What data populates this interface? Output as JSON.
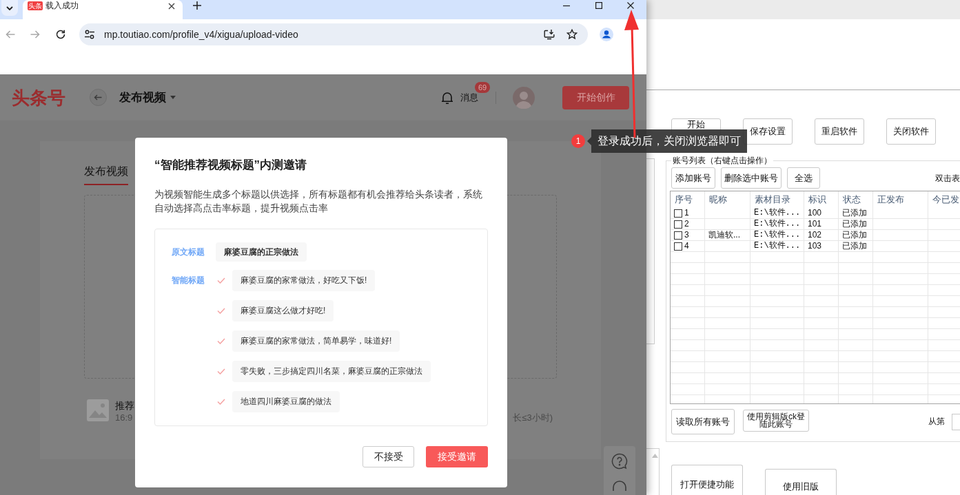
{
  "browser": {
    "tabs": [
      {
        "favicon_text": "头条",
        "title": "载入成功",
        "selected": true
      }
    ],
    "back": {
      "disabled": true
    },
    "forward": {
      "disabled": true
    },
    "address": "mp.toutiao.com/profile_v4/xigua/upload-video"
  },
  "page": {
    "logo": "头条号",
    "section": "发布视频",
    "messages": {
      "label": "消息",
      "badge": "69"
    },
    "create_button": "开始创作",
    "tabs": [
      {
        "label": "发布视频",
        "selected": true
      }
    ],
    "cover": {
      "title": "推荐",
      "note": "16:9"
    },
    "duration_note": "长≤3小时)"
  },
  "dialog": {
    "title": "“智能推荐视频标题”内测邀请",
    "description": "为视频智能生成多个标题以供选择，所有标题都有机会推荐给头条读者，系统自动选择高点击率标题，提升视频点击率",
    "original": {
      "label": "原文标题",
      "title": "麻婆豆腐的正宗做法"
    },
    "smart": {
      "label": "智能标题",
      "titles": [
        {
          "text": "麻婆豆腐的家常做法，好吃又下饭!",
          "checked": true
        },
        {
          "text": "麻婆豆腐这么做才好吃!",
          "checked": true
        },
        {
          "text": "麻婆豆腐的家常做法，简单易学，味道好!",
          "checked": true
        },
        {
          "text": "零失败，三步搞定四川名菜，麻婆豆腐的正宗做法",
          "checked": true
        },
        {
          "text": "地道四川麻婆豆腐的做法",
          "checked": true
        }
      ]
    },
    "buttons": [
      {
        "label": "不接受",
        "kind": "secondary"
      },
      {
        "label": "接受邀请",
        "kind": "primary"
      }
    ]
  },
  "annotation": {
    "step": "1",
    "text": "登录成功后，关闭浏览器即可"
  },
  "app": {
    "buttons": [
      "开始",
      "保存设置",
      "重启软件",
      "关闭软件"
    ],
    "account_list": {
      "title": "账号列表（右键点击操作）",
      "buttons": [
        "添加账号",
        "删除选中账号",
        "全选"
      ],
      "hint": "双击表",
      "table": {
        "columns": [
          "序号",
          "昵称",
          "素材目录",
          "标识",
          "状态",
          "正发布",
          "今已发"
        ],
        "rows": [
          {
            "checked": false,
            "index": "1",
            "folder": "E:\\软件...",
            "id": "100",
            "status": "已添加"
          },
          {
            "checked": false,
            "index": "2",
            "folder": "E:\\软件...",
            "id": "101",
            "status": "已添加"
          },
          {
            "checked": false,
            "index": "3",
            "nickname": "凯迪软...",
            "folder": "E:\\软件...",
            "id": "102",
            "status": "已添加"
          },
          {
            "checked": false,
            "index": "4",
            "folder": "E:\\软件...",
            "id": "103",
            "status": "已添加"
          }
        ]
      },
      "bottom_buttons": [
        "读取所有账号",
        "使用剪辑版ck登陆此账号"
      ],
      "from_label": "从第"
    },
    "footer_buttons": [
      "打开便捷功能",
      "使用旧版"
    ]
  }
}
